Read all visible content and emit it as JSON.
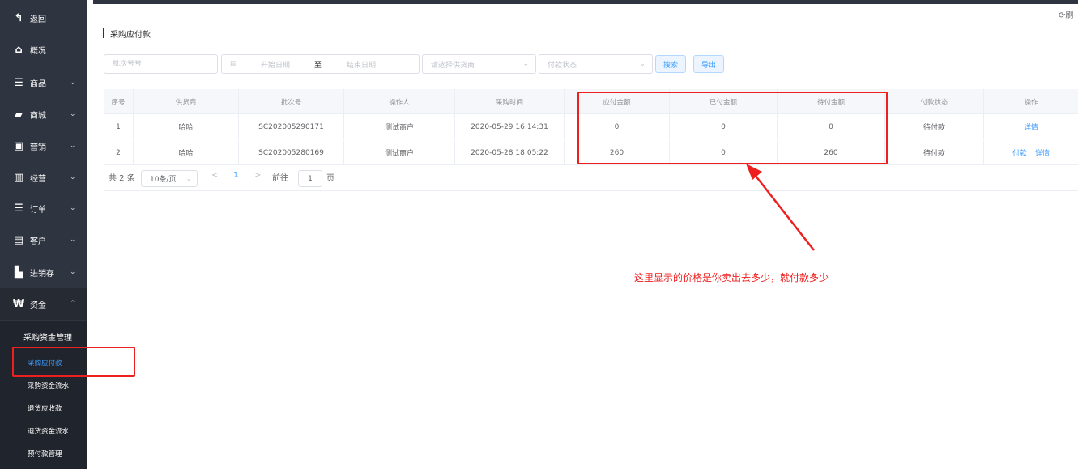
{
  "sidebar": {
    "items": [
      {
        "label": "返回",
        "icon": "back-arrow-icon",
        "glyph": "↰",
        "chevron": ""
      },
      {
        "label": "概况",
        "icon": "home-icon",
        "glyph": "⌂",
        "chevron": ""
      },
      {
        "label": "商品",
        "icon": "list-icon",
        "glyph": "☰",
        "chevron": "⌄"
      },
      {
        "label": "商城",
        "icon": "shopping-bag-icon",
        "glyph": "▰",
        "chevron": "⌄"
      },
      {
        "label": "营销",
        "icon": "gift-icon",
        "glyph": "▣",
        "chevron": "⌄"
      },
      {
        "label": "经营",
        "icon": "bar-chart-icon",
        "glyph": "▥",
        "chevron": "⌄"
      },
      {
        "label": "订单",
        "icon": "order-list-icon",
        "glyph": "☰",
        "chevron": "⌄"
      },
      {
        "label": "客户",
        "icon": "id-card-icon",
        "glyph": "▤",
        "chevron": "⌄"
      },
      {
        "label": "进销存",
        "icon": "truck-icon",
        "glyph": "▙",
        "chevron": "⌄"
      },
      {
        "label": "资金",
        "icon": "won-currency-icon",
        "glyph": "₩",
        "chevron": "⌃"
      }
    ],
    "submenu_header": "采购资金管理",
    "submenu_items": [
      {
        "label": "采购应付款",
        "active": true
      },
      {
        "label": "采购资金流水",
        "active": false
      },
      {
        "label": "退货应收款",
        "active": false
      },
      {
        "label": "退货资金流水",
        "active": false
      },
      {
        "label": "预付款管理",
        "active": false
      }
    ]
  },
  "header": {
    "refresh_label": "⟳刷"
  },
  "page": {
    "title": "采购应付款"
  },
  "filters": {
    "batch_placeholder": "批次号号",
    "start_date": "开始日期",
    "to": "至",
    "end_date": "结束日期",
    "supplier_placeholder": "请选择供货商",
    "status_placeholder": "付款状态",
    "search_label": "搜索",
    "export_label": "导出"
  },
  "table": {
    "columns": [
      "序号",
      "供货商",
      "批次号",
      "操作人",
      "采购时间",
      "应付金额",
      "已付金额",
      "待付金额",
      "付款状态",
      "操作"
    ],
    "rows": [
      {
        "no": "1",
        "supplier": "哈哈",
        "batch": "SC202005290171",
        "operator": "测试商户",
        "time": "2020-05-29 16:14:31",
        "payable": "0",
        "paid": "0",
        "pending": "0",
        "status": "待付款",
        "actions": [
          "详情"
        ]
      },
      {
        "no": "2",
        "supplier": "哈哈",
        "batch": "SC202005280169",
        "operator": "测试商户",
        "time": "2020-05-28 18:05:22",
        "payable": "260",
        "paid": "0",
        "pending": "260",
        "status": "待付款",
        "actions": [
          "付款",
          "详情"
        ]
      }
    ]
  },
  "pagination": {
    "total": "共 2 条",
    "page_size": "10条/页",
    "prev": "<",
    "current": "1",
    "next": ">",
    "goto": "前往",
    "goto_value": "1",
    "page_unit": "页"
  },
  "annotation": {
    "text": "这里显示的价格是你卖出去多少，就付款多少",
    "color": "#ee1f1f"
  }
}
